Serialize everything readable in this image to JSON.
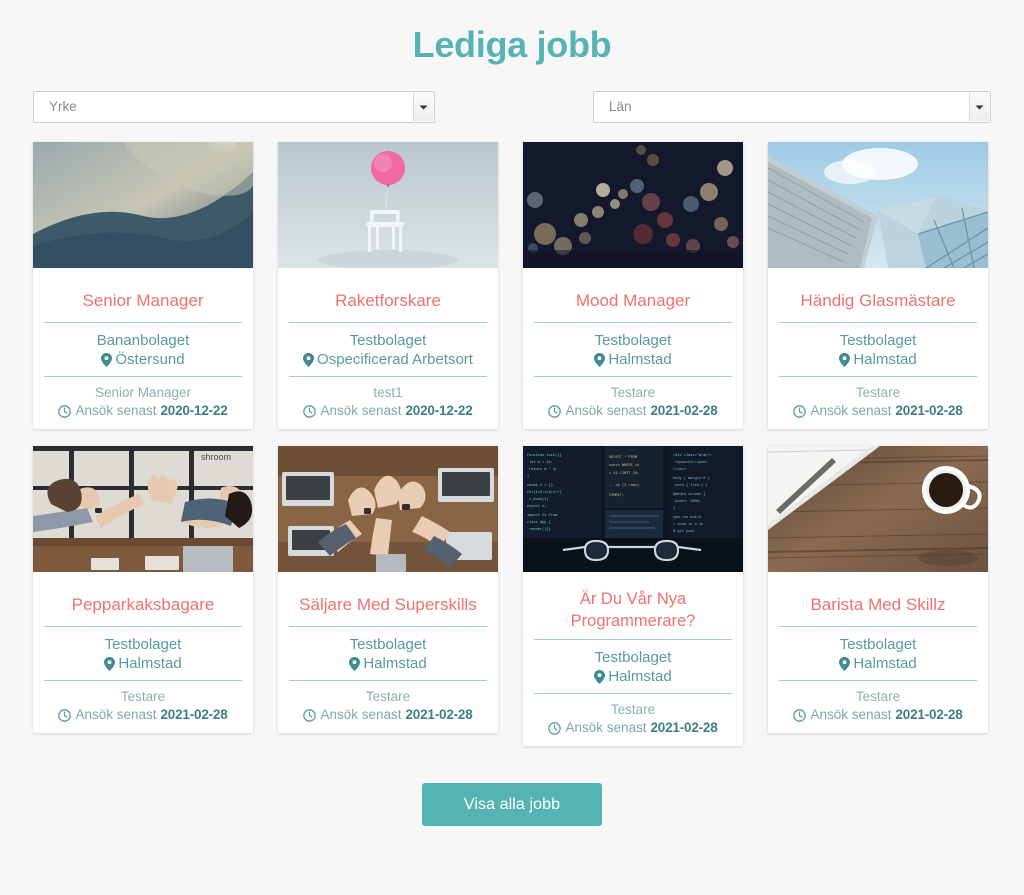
{
  "page": {
    "title": "Lediga jobb",
    "background_color": "#f7f7f7",
    "accent_color": "#56b3b4",
    "title_color": "#56b3b4",
    "job_title_color": "#f1716c",
    "divider_color": "#9fd1d0"
  },
  "filters": [
    {
      "name": "yrke",
      "placeholder": "Yrke",
      "value": "Yrke",
      "icon": "chevron-down-icon"
    },
    {
      "name": "lan",
      "placeholder": "Län",
      "value": "Län",
      "icon": "chevron-down-icon"
    }
  ],
  "labels": {
    "deadline_prefix": "Ansök senast",
    "location_icon": "map-pin-icon",
    "clock_icon": "clock-icon"
  },
  "jobs": [
    {
      "title": "Senior Manager",
      "company": "Bananbolaget",
      "location": "Östersund",
      "role": "Senior Manager",
      "deadline_prefix": "Ansök senast",
      "deadline": "2020-12-22",
      "image": "sand-dune-sun"
    },
    {
      "title": "Raketforskare",
      "company": "Testbolaget",
      "location": "Ospecificerad Arbetsort",
      "role": "test1",
      "deadline_prefix": "Ansök senast",
      "deadline": "2020-12-22",
      "image": "pink-balloon-chair"
    },
    {
      "title": "Mood Manager",
      "company": "Testbolaget",
      "location": "Halmstad",
      "role": "Testare",
      "deadline_prefix": "Ansök senast",
      "deadline": "2021-02-28",
      "image": "night-city-bokeh"
    },
    {
      "title": "Händig Glasmästare",
      "company": "Testbolaget",
      "location": "Halmstad",
      "role": "Testare",
      "deadline_prefix": "Ansök senast",
      "deadline": "2021-02-28",
      "image": "glass-architecture-sky"
    },
    {
      "title": "Pepparkaksbagare",
      "company": "Testbolaget",
      "location": "Halmstad",
      "role": "Testare",
      "deadline_prefix": "Ansök senast",
      "deadline": "2021-02-28",
      "image": "team-high-five"
    },
    {
      "title": "Säljare Med Superskills",
      "company": "Testbolaget",
      "location": "Halmstad",
      "role": "Testare",
      "deadline_prefix": "Ansök senast",
      "deadline": "2021-02-28",
      "image": "team-hands-desk"
    },
    {
      "title": "Är Du Vår Nya Programmerare?",
      "company": "Testbolaget",
      "location": "Halmstad",
      "role": "Testare",
      "deadline_prefix": "Ansök senast",
      "deadline": "2021-02-28",
      "image": "code-screens-glasses"
    },
    {
      "title": "Barista Med Skillz",
      "company": "Testbolaget",
      "location": "Halmstad",
      "role": "Testare",
      "deadline_prefix": "Ansök senast",
      "deadline": "2021-02-28",
      "image": "coffee-wood-notebook"
    }
  ],
  "footer": {
    "show_all_label": "Visa alla jobb"
  }
}
